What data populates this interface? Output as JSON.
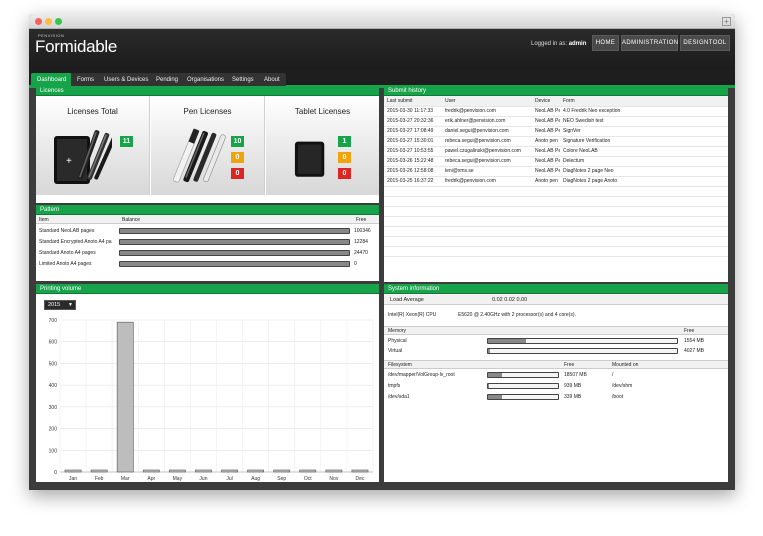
{
  "window": {
    "controls": [
      "close",
      "minimize",
      "maximize"
    ],
    "expand_icon": "expand-icon"
  },
  "header": {
    "brand_small": "PENVISION",
    "brand": "Formidable",
    "logged_in_label": "Logged in as:",
    "user": "admin",
    "buttons": [
      "HOME",
      "ADMINISTRATION",
      "DESIGNTOOL"
    ]
  },
  "nav": {
    "tabs": [
      "Dashboard",
      "Forms",
      "Users & Devices",
      "Pending",
      "Organisations",
      "Settings",
      "About"
    ],
    "active": "Dashboard"
  },
  "licences": {
    "title": "Licences",
    "cards": [
      {
        "title": "Licenses Total",
        "badges": [
          {
            "value": "11",
            "color": "#16a34a"
          }
        ],
        "icon": "tablet-and-pens-icon"
      },
      {
        "title": "Pen Licenses",
        "badges": [
          {
            "value": "10",
            "color": "#16a34a"
          },
          {
            "value": "0",
            "color": "#f0a30a"
          },
          {
            "value": "0",
            "color": "#dc2626"
          }
        ],
        "icon": "pens-icon"
      },
      {
        "title": "Tablet Licenses",
        "badges": [
          {
            "value": "1",
            "color": "#16a34a"
          },
          {
            "value": "0",
            "color": "#f0a30a"
          },
          {
            "value": "0",
            "color": "#dc2626"
          }
        ],
        "icon": "tablet-icon"
      }
    ]
  },
  "submit_history": {
    "title": "Submit history",
    "columns": [
      "Last submit",
      "User",
      "Device",
      "Form"
    ],
    "rows": [
      [
        "2015-03-30 11:17:33",
        "fredrik@penvision.com",
        "NeoLAB Pe",
        "4.0  Fredrik Neo exception"
      ],
      [
        "2015-03-27 20:32:36",
        "erik.ahlner@penvision.com",
        "NeoLAB Pe",
        "NEO Swedish test"
      ],
      [
        "2015-03-27 17:08:49",
        "daniel.segui@penvision.com",
        "NeoLAB Pe",
        "SignVer"
      ],
      [
        "2015-03-27 15:30:01",
        "rebeca.segui@penvision.com",
        "Anoto pen",
        "Signature Verification"
      ],
      [
        "2015-03-27 10:53:55",
        "pawel.czugalinski@penvision.com",
        "NeoLAB Pe",
        "Colore NeoLAB"
      ],
      [
        "2015-03-26 15:22:48",
        "rebeca.segui@penvision.com",
        "NeoLAB Pe",
        "Delectum"
      ],
      [
        "2015-03-26 12:58:08",
        "leni@xms.se",
        "NeoLAB Pe",
        "DiagNotes 2 page Neo"
      ],
      [
        "2015-03-25 16:37:22",
        "fredrik@penvision.com",
        "Anoto pen",
        "DiagNotes 2 page Anoto"
      ]
    ]
  },
  "pattern": {
    "title": "Pattern",
    "columns": [
      "Item",
      "Balance",
      "Free"
    ],
    "rows": [
      {
        "item": "Standard NeoLAB pages",
        "free": "100346",
        "fill": 1.0
      },
      {
        "item": "Standard Encrypted Anoto A4 pa",
        "free": "12284",
        "fill": 1.0
      },
      {
        "item": "Standard Anoto A4 pages",
        "free": "24470",
        "fill": 1.0
      },
      {
        "item": "Limited Anoto A4 pages",
        "free": "0",
        "fill": 1.0
      }
    ]
  },
  "printing_volume": {
    "title": "Printing volume",
    "year": "2015"
  },
  "chart_data": {
    "type": "bar",
    "categories": [
      "Jan",
      "Feb",
      "Mar",
      "Apr",
      "May",
      "Jun",
      "Jul",
      "Aug",
      "Sep",
      "Oct",
      "Nov",
      "Dec"
    ],
    "values": [
      0,
      0,
      690,
      0,
      0,
      0,
      0,
      0,
      0,
      0,
      0,
      0
    ],
    "yticks": [
      "0",
      "100",
      "200",
      "300",
      "400",
      "500",
      "600",
      "700"
    ],
    "ylim": [
      0,
      700
    ],
    "grid": true
  },
  "system_info": {
    "title": "System information",
    "load_label": "Load Average",
    "load_value": "0.02 0.02 0.00",
    "cpu_label": "Intel(R) Xeon(R) CPU",
    "cpu_value": "E5620  @ 2.40GHz with 2 processor(s) and 4 core(s).",
    "memory_label": "Memory",
    "free_label": "Free",
    "memory": [
      {
        "name": "Physical",
        "free": "1554 MB",
        "used_fraction": 0.2
      },
      {
        "name": "Virtual",
        "free": "4027 MB",
        "used_fraction": 0.01
      }
    ],
    "fs_columns": [
      "Filesystem",
      "Free",
      "Mounted on"
    ],
    "filesystems": [
      {
        "name": "/dev/mapper/VolGroup-lv_root",
        "free": "18507 MB",
        "mount": "/",
        "used_fraction": 0.2
      },
      {
        "name": "tmpfs",
        "free": "939 MB",
        "mount": "/dev/shm",
        "used_fraction": 0.01
      },
      {
        "name": "/dev/sda1",
        "free": "339 MB",
        "mount": "/boot",
        "used_fraction": 0.2
      }
    ]
  }
}
